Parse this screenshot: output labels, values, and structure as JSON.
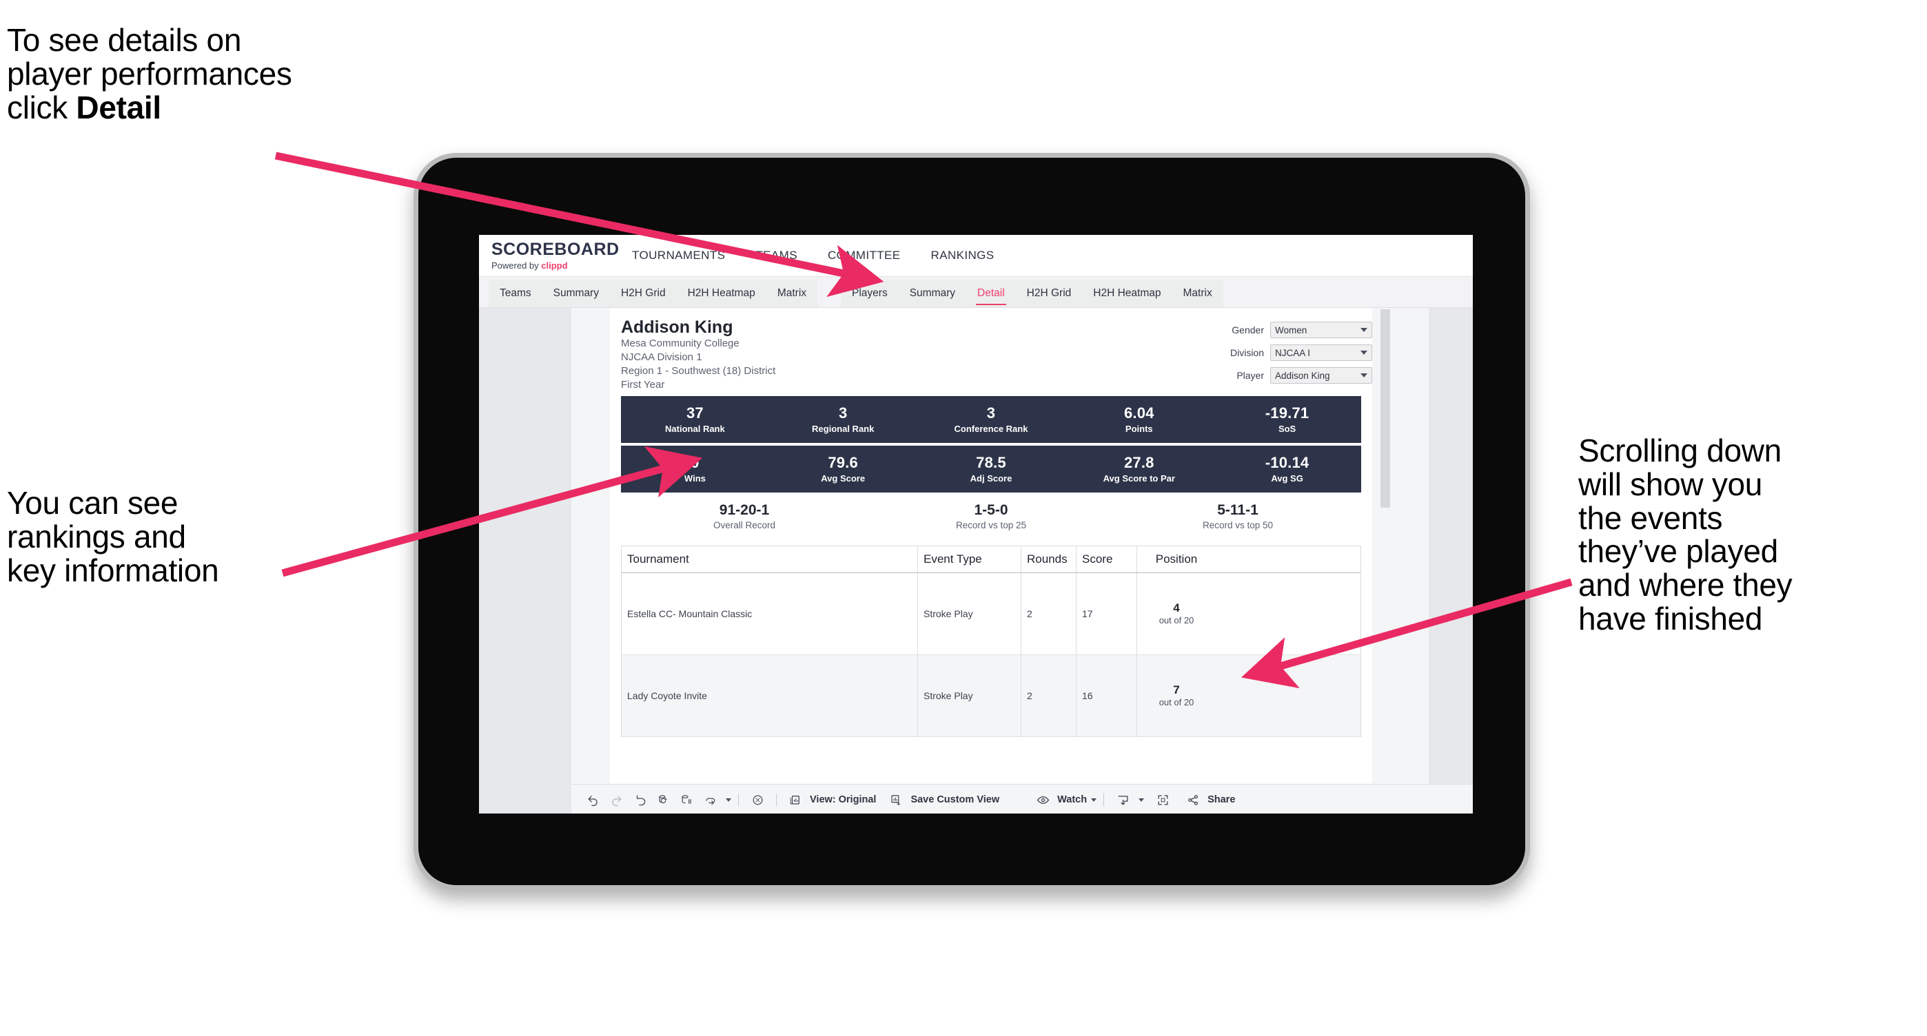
{
  "annotations": {
    "top_left": {
      "line1": "To see details on",
      "line2": "player performances",
      "line3_prefix": "click ",
      "line3_bold": "Detail"
    },
    "mid_left": {
      "line1": "You can see",
      "line2": "rankings and",
      "line3": "key information"
    },
    "right": {
      "line1": "Scrolling down",
      "line2": "will show you",
      "line3": "the events",
      "line4": "they’ve played",
      "line5": "and where they",
      "line6": "have finished"
    },
    "arrow_color": "#ea2a62"
  },
  "app": {
    "brand": {
      "title": "SCOREBOARD",
      "powered_prefix": "Powered by ",
      "powered_name": "clippd"
    },
    "top_nav": [
      {
        "label": "TOURNAMENTS"
      },
      {
        "label": "TEAMS"
      },
      {
        "label": "COMMITTEE"
      },
      {
        "label": "RANKINGS"
      }
    ],
    "tab_groups": [
      {
        "name": "teams-group",
        "tabs": [
          {
            "label": "Teams",
            "active": false
          },
          {
            "label": "Summary",
            "active": false
          },
          {
            "label": "H2H Grid",
            "active": false
          },
          {
            "label": "H2H Heatmap",
            "active": false
          },
          {
            "label": "Matrix",
            "active": false
          }
        ]
      },
      {
        "name": "players-group",
        "tabs": [
          {
            "label": "Players",
            "active": false
          },
          {
            "label": "Summary",
            "active": false
          },
          {
            "label": "Detail",
            "active": true
          },
          {
            "label": "H2H Grid",
            "active": false
          },
          {
            "label": "H2H Heatmap",
            "active": false
          },
          {
            "label": "Matrix",
            "active": false
          }
        ]
      }
    ],
    "accent_color": "#ef3e6d",
    "navy_color": "#2d3449"
  },
  "player": {
    "name": "Addison King",
    "school": "Mesa Community College",
    "division": "NJCAA Division 1",
    "region": "Region 1 - Southwest (18) District",
    "year": "First Year"
  },
  "filters": [
    {
      "label": "Gender",
      "value": "Women"
    },
    {
      "label": "Division",
      "value": "NJCAA I"
    },
    {
      "label": "Player",
      "value": "Addison King"
    }
  ],
  "stats_row_1": [
    {
      "value": "37",
      "label": "National Rank"
    },
    {
      "value": "3",
      "label": "Regional Rank"
    },
    {
      "value": "3",
      "label": "Conference Rank"
    },
    {
      "value": "6.04",
      "label": "Points"
    },
    {
      "value": "-19.71",
      "label": "SoS"
    }
  ],
  "stats_row_2": [
    {
      "value": "0",
      "label": "Wins"
    },
    {
      "value": "79.6",
      "label": "Avg Score"
    },
    {
      "value": "78.5",
      "label": "Adj Score"
    },
    {
      "value": "27.8",
      "label": "Avg Score to Par"
    },
    {
      "value": "-10.14",
      "label": "Avg SG"
    }
  ],
  "records": [
    {
      "value": "91-20-1",
      "label": "Overall Record"
    },
    {
      "value": "1-5-0",
      "label": "Record vs top 25"
    },
    {
      "value": "5-11-1",
      "label": "Record vs top 50"
    }
  ],
  "events_table": {
    "columns": [
      "Tournament",
      "Event Type",
      "Rounds",
      "Score",
      "Position"
    ],
    "rows": [
      {
        "tournament": "Estella CC- Mountain Classic",
        "event_type": "Stroke Play",
        "rounds": "2",
        "score": "17",
        "position_value": "4",
        "position_sub": "out of 20"
      },
      {
        "tournament": "Lady Coyote Invite",
        "event_type": "Stroke Play",
        "rounds": "2",
        "score": "16",
        "position_value": "7",
        "position_sub": "out of 20"
      }
    ]
  },
  "toolbar": {
    "view_label": "View: Original",
    "save_label": "Save Custom View",
    "watch_label": "Watch",
    "share_label": "Share"
  }
}
